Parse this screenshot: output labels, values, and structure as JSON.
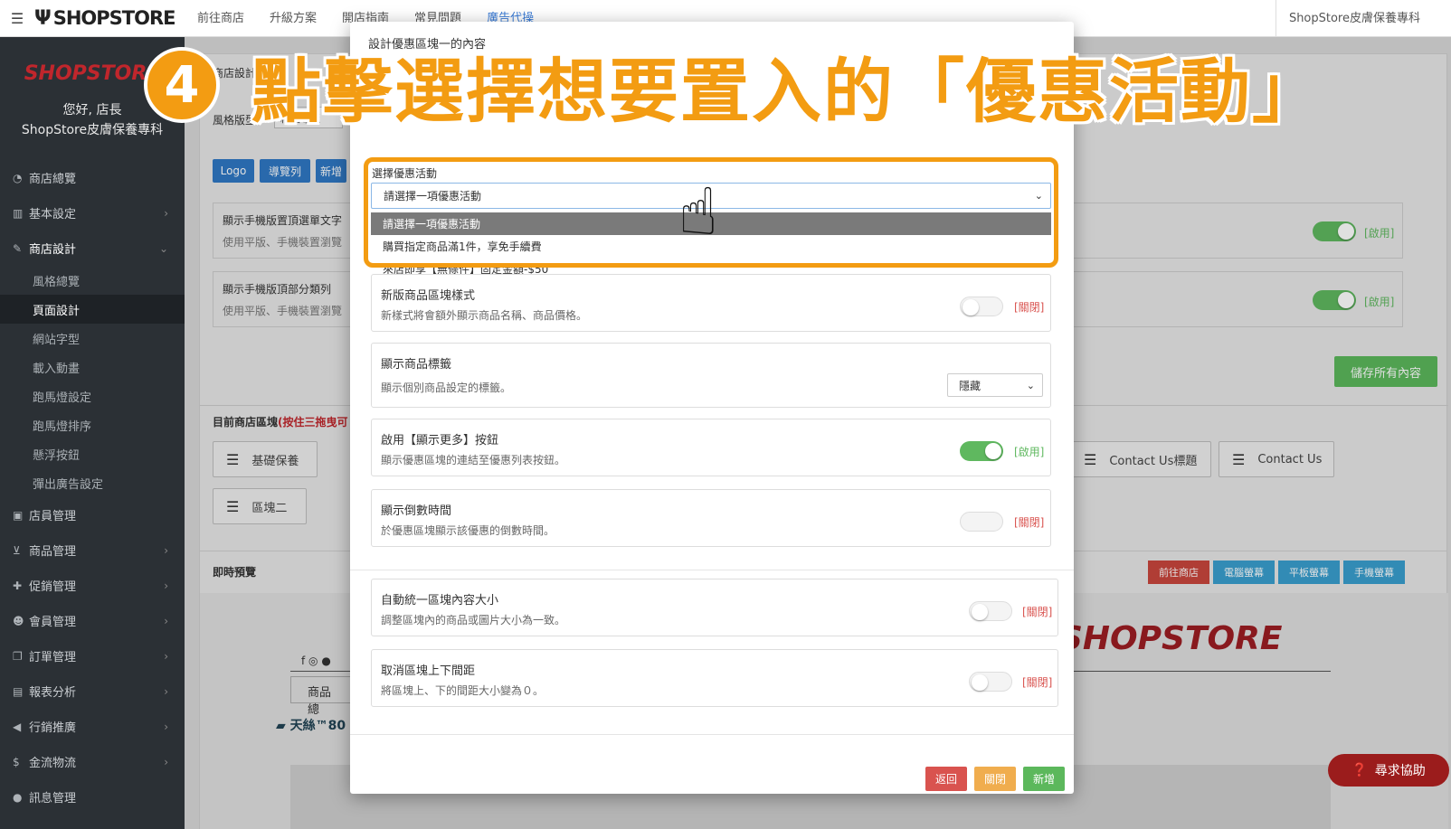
{
  "topbar": {
    "brand": "SHOPSTORE",
    "nav": [
      "前往商店",
      "升級方案",
      "開店指南",
      "常見問題",
      "廣告代操"
    ],
    "shop_name": "ShopStore皮膚保養專科"
  },
  "sidebar": {
    "logo": "SHOPSTORE",
    "greeting": "您好, 店長",
    "shop_name": "ShopStore皮膚保養專科",
    "items": [
      {
        "label": "商店總覽",
        "icon": "dashboard-icon"
      },
      {
        "label": "基本設定",
        "icon": "bank-icon"
      },
      {
        "label": "商店設計",
        "icon": "brush-icon"
      },
      {
        "label": "店員管理",
        "icon": "lock-icon"
      },
      {
        "label": "商品管理",
        "icon": "cart-icon"
      },
      {
        "label": "促銷管理",
        "icon": "gift-icon"
      },
      {
        "label": "會員管理",
        "icon": "users-icon"
      },
      {
        "label": "訂單管理",
        "icon": "copy-icon"
      },
      {
        "label": "報表分析",
        "icon": "chart-icon"
      },
      {
        "label": "行銷推廣",
        "icon": "bullhorn-icon"
      },
      {
        "label": "金流物流",
        "icon": "dollar-icon"
      },
      {
        "label": "訊息管理",
        "icon": "comments-icon"
      }
    ],
    "sub_items": [
      "風格總覽",
      "頁面設計",
      "網站字型",
      "載入動畫",
      "跑馬燈設定",
      "跑馬燈排序",
      "懸浮按鈕",
      "彈出廣告設定"
    ]
  },
  "background": {
    "section_label": "商店設計",
    "style_label": "風格版型",
    "style_value": "精品專櫃",
    "tab_buttons": [
      "Logo",
      "導覽列",
      "新增"
    ],
    "row1_title": "顯示手機版置頂選單文字",
    "row1_desc": "使用平版、手機裝置瀏覽",
    "row2_title": "顯示手機版頂部分類列",
    "row2_desc": "使用平版、手機裝置瀏覽",
    "enabled_label": "[啟用]",
    "save_all": "儲存所有內容",
    "blocks_label": "目前商店區塊",
    "blocks_hint": "(按住三拖曳可",
    "blocks": [
      "基礎保養",
      "區塊二",
      "Contact Us標題",
      "Contact Us"
    ],
    "preview_label": "即時預覽",
    "preview_buttons": [
      "前往商店",
      "電腦螢幕",
      "平板螢幕",
      "手機螢幕"
    ],
    "preview_logo": "SHOPSTORE",
    "preview_nav": "商品總",
    "preview_marquee": "天絲™80"
  },
  "modal": {
    "title": "設計優惠區塊一的內容",
    "select_label": "選擇優惠活動",
    "select_value": "請選擇一項優惠活動",
    "options": [
      "請選擇一項優惠活動",
      "購買指定商品滿1件，享免手續費",
      "來店即享【無條件】固定金額-$50"
    ],
    "settings": [
      {
        "title": "新版商品區塊樣式",
        "desc": "新樣式將會額外顯示商品名稱、商品價格。",
        "state": "off",
        "state_label": "[關閉]"
      },
      {
        "title": "顯示商品標籤",
        "desc": "顯示個別商品設定的標籤。",
        "select_value": "隱藏"
      },
      {
        "title": "啟用【顯示更多】按鈕",
        "desc": "顯示優惠區塊的連結至優惠列表按鈕。",
        "state": "on",
        "state_label": "[啟用]"
      },
      {
        "title": "顯示倒數時間",
        "desc": "於優惠區塊顯示該優惠的倒數時間。",
        "state": "off",
        "state_label": "[關閉]"
      },
      {
        "title": "自動統一區塊內容大小",
        "desc": "調整區塊內的商品或圖片大小為一致。",
        "state": "off",
        "state_label": "[關閉]"
      },
      {
        "title": "取消區塊上下間距",
        "desc": "將區塊上、下的間距大小變為０。",
        "state": "off",
        "state_label": "[關閉]"
      }
    ],
    "buttons": {
      "back": "返回",
      "close": "關閉",
      "add": "新增"
    }
  },
  "annotation": {
    "step_number": "4",
    "instruction": "點擊選擇想要置入的「優惠活動」"
  },
  "help_button": "尋求協助",
  "colors": {
    "accent_orange": "#f39c12",
    "toggle_on": "#5fb85f",
    "off_red": "#d9534f",
    "primary_blue": "#2f78c4",
    "brand_red": "#c0262c"
  }
}
